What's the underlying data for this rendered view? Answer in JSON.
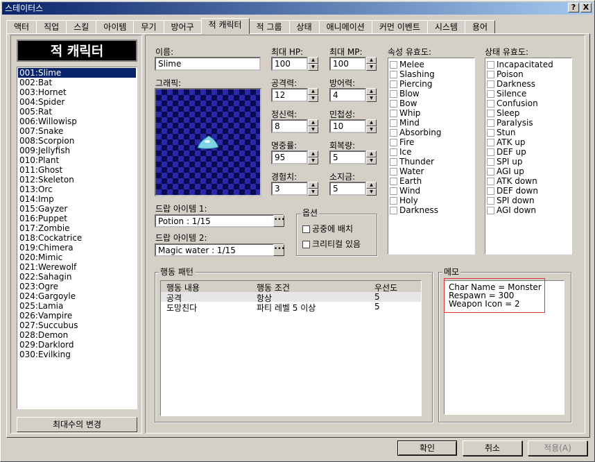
{
  "window": {
    "title": "스테이터스",
    "help_label": "?",
    "close_label": "X"
  },
  "tabs": [
    "액터",
    "직업",
    "스킬",
    "아이템",
    "무기",
    "방어구",
    "적 캐릭터",
    "적 그룹",
    "상태",
    "애니메이션",
    "커먼 이벤트",
    "시스템",
    "용어"
  ],
  "active_tab": "적 캐릭터",
  "sidebar": {
    "header": "적 캐릭터",
    "items": [
      "001:Slime",
      "002:Bat",
      "003:Hornet",
      "004:Spider",
      "005:Rat",
      "006:Willowisp",
      "007:Snake",
      "008:Scorpion",
      "009:Jellyfish",
      "010:Plant",
      "011:Ghost",
      "012:Skeleton",
      "013:Orc",
      "014:Imp",
      "015:Gayzer",
      "016:Puppet",
      "017:Zombie",
      "018:Cockatrice",
      "019:Chimera",
      "020:Mimic",
      "021:Werewolf",
      "022:Sahagin",
      "023:Ogre",
      "024:Gargoyle",
      "025:Lamia",
      "026:Vampire",
      "027:Succubus",
      "028:Demon",
      "029:Darklord",
      "030:Evilking"
    ],
    "selected_index": 0,
    "change_max_button": "최대수의 변경"
  },
  "form": {
    "name_label": "이름:",
    "name_value": "Slime",
    "graphic_label": "그래픽:",
    "max_hp_label": "최대 HP:",
    "max_hp": "100",
    "max_mp_label": "최대 MP:",
    "max_mp": "100",
    "atk_label": "공격력:",
    "atk": "12",
    "def_label": "방어력:",
    "def": "4",
    "spi_label": "정신력:",
    "spi": "8",
    "agi_label": "민첩성:",
    "agi": "10",
    "hit_label": "명중률:",
    "hit": "95",
    "eva_label": "회복량:",
    "eva": "5",
    "exp_label": "경험치:",
    "exp": "3",
    "gold_label": "소지금:",
    "gold": "5",
    "drop1_label": "드랍 아이템 1:",
    "drop1": "Potion : 1/15",
    "drop2_label": "드랍 아이템 2:",
    "drop2": "Magic water : 1/15",
    "options_title": "옵션",
    "opt_levitate": "공중에 배치",
    "opt_critical": "크리티컬 있음",
    "element_title": "속성 유효도:",
    "elements": [
      "Melee",
      "Slashing",
      "Piercing",
      "Blow",
      "Bow",
      "Whip",
      "Mind",
      "Absorbing",
      "Fire",
      "Ice",
      "Thunder",
      "Water",
      "Earth",
      "Wind",
      "Holy",
      "Darkness"
    ],
    "state_title": "상태 유효도:",
    "states": [
      "Incapacitated",
      "Poison",
      "Darkness",
      "Silence",
      "Confusion",
      "Sleep",
      "Paralysis",
      "Stun",
      "ATK up",
      "DEF up",
      "SPI up",
      "AGI up",
      "ATK down",
      "DEF down",
      "SPI down",
      "AGI down"
    ]
  },
  "actions": {
    "title": "행동 패턴",
    "headers": [
      "행동 내용",
      "행동 조건",
      "우선도"
    ],
    "rows": [
      [
        "공격",
        "항상",
        "5"
      ],
      [
        "도망친다",
        "파티 레벨 5 이상",
        "5"
      ]
    ]
  },
  "memo": {
    "title": "메모",
    "lines": [
      "Char Name = Monster",
      "Respawn = 300",
      "Weapon Icon = 2"
    ]
  },
  "footer": {
    "ok": "확인",
    "cancel": "취소",
    "apply": "적용(A)"
  }
}
